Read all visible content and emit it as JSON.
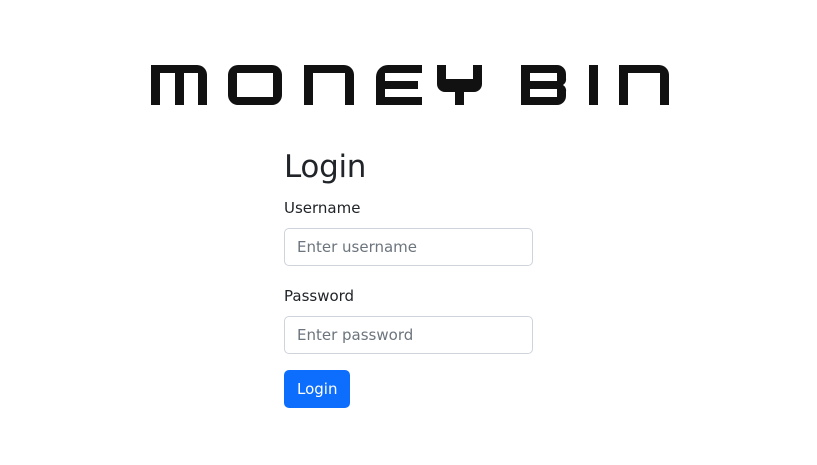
{
  "brand": {
    "logo_text": "MONEY BIN"
  },
  "login": {
    "title": "Login",
    "username_label": "Username",
    "username_placeholder": "Enter username",
    "username_value": "",
    "password_label": "Password",
    "password_placeholder": "Enter password",
    "password_value": "",
    "submit_label": "Login"
  },
  "colors": {
    "primary": "#0d6efd",
    "text": "#212529",
    "placeholder": "#6c757d",
    "input_border": "#ced4da",
    "logo": "#111111"
  }
}
